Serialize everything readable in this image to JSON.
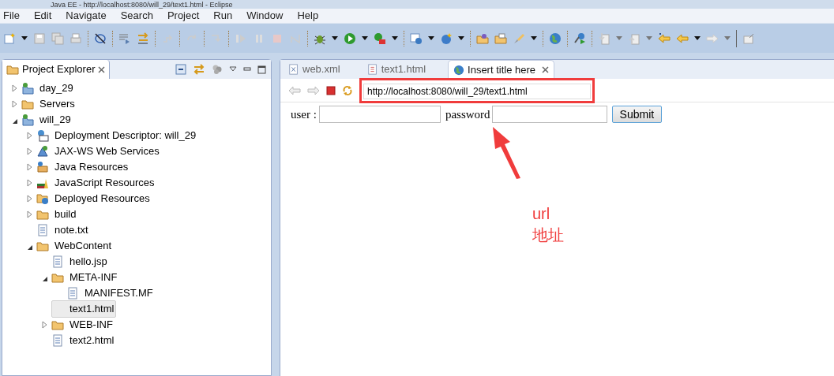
{
  "window": {
    "title": "Java EE - http://localhost:8080/will_29/text1.html - Eclipse"
  },
  "menu": [
    "File",
    "Edit",
    "Navigate",
    "Search",
    "Project",
    "Run",
    "Window",
    "Help"
  ],
  "explorer": {
    "title": "Project Explorer",
    "tree": [
      {
        "label": "day_29",
        "kind": "project",
        "expanded": false,
        "selected": false
      },
      {
        "label": "Servers",
        "kind": "folder",
        "expanded": false,
        "selected": false
      },
      {
        "label": "will_29",
        "kind": "project",
        "expanded": true,
        "selected": false,
        "children": [
          {
            "label": "Deployment Descriptor: will_29",
            "kind": "descriptor",
            "expanded": false,
            "selected": false
          },
          {
            "label": "JAX-WS Web Services",
            "kind": "services",
            "expanded": false,
            "selected": false
          },
          {
            "label": "Java Resources",
            "kind": "java",
            "expanded": false,
            "selected": false
          },
          {
            "label": "JavaScript Resources",
            "kind": "javascript",
            "expanded": false,
            "selected": false
          },
          {
            "label": "Deployed Resources",
            "kind": "deployed",
            "expanded": false,
            "selected": false
          },
          {
            "label": "build",
            "kind": "folder",
            "expanded": false,
            "selected": false
          },
          {
            "label": "note.txt",
            "kind": "file",
            "selected": false
          },
          {
            "label": "WebContent",
            "kind": "folder",
            "expanded": true,
            "selected": false,
            "children": [
              {
                "label": "hello.jsp",
                "kind": "file",
                "selected": false
              },
              {
                "label": "META-INF",
                "kind": "folder",
                "expanded": true,
                "selected": false,
                "children": [
                  {
                    "label": "MANIFEST.MF",
                    "kind": "file",
                    "selected": false
                  }
                ]
              },
              {
                "label": "text1.html",
                "kind": "file",
                "selected": true
              },
              {
                "label": "WEB-INF",
                "kind": "folder",
                "expanded": false,
                "selected": false
              },
              {
                "label": "text2.html",
                "kind": "file",
                "selected": false
              }
            ]
          }
        ]
      }
    ]
  },
  "editor_tabs": [
    {
      "label": "web.xml",
      "kind": "xml",
      "selected": false
    },
    {
      "label": "text1.html",
      "kind": "html",
      "selected": false
    },
    {
      "label": "Insert title here",
      "kind": "browser",
      "selected": true
    }
  ],
  "browser": {
    "url": "http://localhost:8080/will_29/text1.html"
  },
  "form": {
    "user_label": "user :",
    "password_label": "password",
    "submit": "Submit"
  },
  "annotation": {
    "lines": [
      "url",
      "地址"
    ]
  }
}
